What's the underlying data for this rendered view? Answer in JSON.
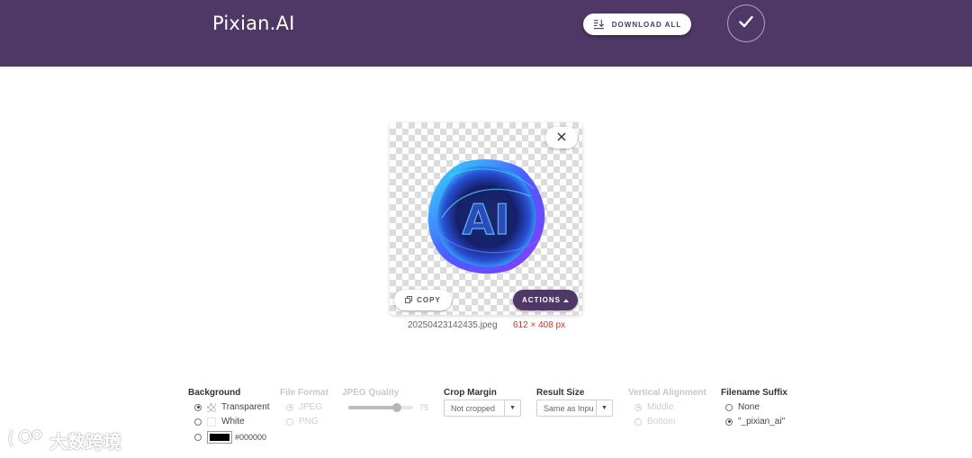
{
  "header": {
    "brand": "Pixian.AI",
    "download_all_label": "DOWNLOAD ALL",
    "download_icon": "download-list-icon",
    "confirm_icon": "check-icon"
  },
  "result_card": {
    "close_icon": "close-icon",
    "image_text": "AI",
    "copy_label": "COPY",
    "copy_icon": "copy-icon",
    "actions_label": "ACTIONS",
    "actions_icon": "caret-up-icon",
    "filename": "20250423142435.jpeg",
    "dimensions": "612 × 408 px"
  },
  "options": {
    "background": {
      "title": "Background",
      "transparent_label": "Transparent",
      "white_label": "White",
      "color_value": "#000000",
      "selected": "Transparent"
    },
    "file_format": {
      "title": "File Format",
      "jpeg_label": "JPEG",
      "png_label": "PNG",
      "selected": "JPEG"
    },
    "jpeg_quality": {
      "title": "JPEG Quality",
      "value": "75",
      "min": 0,
      "max": 100
    },
    "crop_margin": {
      "title": "Crop Margin",
      "value": "Not cropped"
    },
    "result_size": {
      "title": "Result Size",
      "value": "Same as Inpu"
    },
    "vertical_alignment": {
      "title": "Vertical Alignment",
      "middle_label": "Middle",
      "bottom_label": "Bottom",
      "selected": "Middle"
    },
    "filename_suffix": {
      "title": "Filename Suffix",
      "none_label": "None",
      "pixian_label": "\"_pixian_ai\"",
      "selected": "\"_pixian_ai\""
    }
  },
  "watermark": {
    "text": "大数跨境"
  },
  "colors": {
    "brand_purple": "#4f3866",
    "size_red": "#c0392b"
  }
}
